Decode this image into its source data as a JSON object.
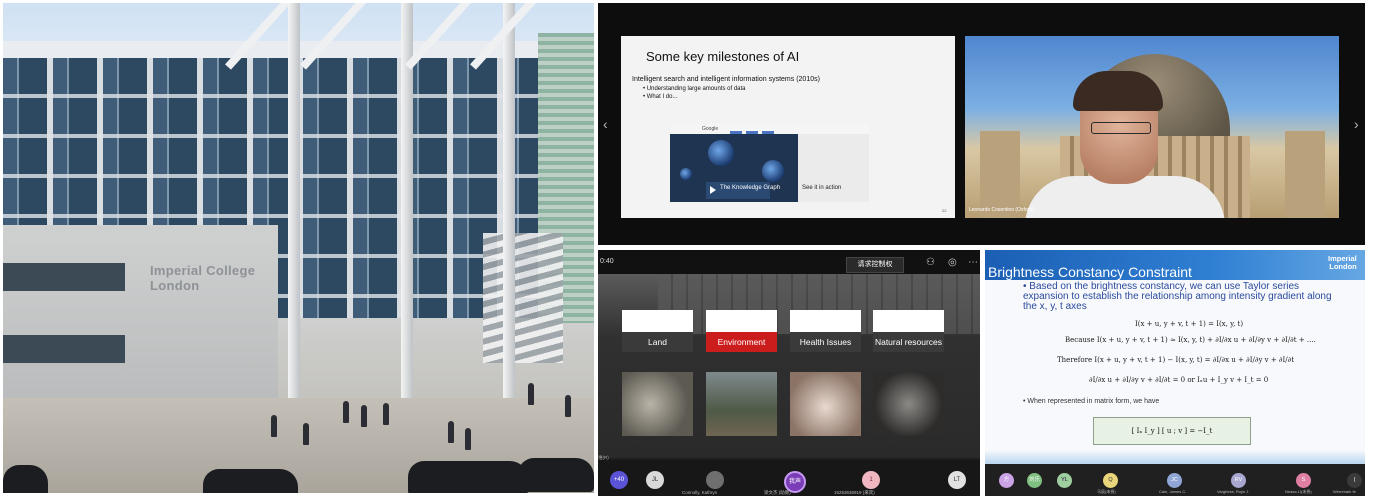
{
  "building": {
    "sign_line1": "Imperial College",
    "sign_line2": "London"
  },
  "lecture": {
    "slide_title": "Some key milestones of AI",
    "slide_subtitle": "Intelligent search and intelligent information systems (2010s)",
    "bullets": [
      "• Understanding large amounts of data",
      "• What I do..."
    ],
    "screenshot_logo": "Google",
    "knowledge_graph_label": "The Knowledge Graph",
    "see_it_label": "See it in action",
    "page_number": "22",
    "speaker_tag": "Leonardo Cosentino (Oxford)",
    "nav_prev": "‹",
    "nav_next": "›"
  },
  "meeting": {
    "time": "0:40",
    "control_button": "请求控制权",
    "categories": [
      "Land",
      "Environment",
      "Health Issues",
      "Natural resources"
    ],
    "highlight_color": "#cc1d1d",
    "participants": [
      "+40",
      "JL",
      "",
      "我声",
      "1",
      "LT"
    ],
    "names": [
      "Connolly, Kathryn",
      "梁文杰 (助教)",
      "15253636919 (来宾)"
    ],
    "side_label": "谁(R)"
  },
  "vision_slide": {
    "title": "Brightness Constancy Constraint",
    "logo_line1": "Imperial",
    "logo_line2": "London",
    "bullet": "• Based on the brightness constancy, we can use Taylor series expansion to establish the relationship among intensity gradient along the x, y, t axes",
    "eq1": "I(x + u, y + v, t + 1) = I(x, y, t)",
    "eq2": "Because  I(x + u, y + v, t + 1) ≈ I(x, y, t) + ∂I/∂x u + ∂I/∂y v + ∂I/∂t + ....",
    "eq3": "Therefore   I(x + u, y + v, t + 1) − I(x, y, t) = ∂I/∂x u + ∂I/∂y v + ∂I/∂t",
    "eq4": "∂I/∂x u + ∂I/∂y v + ∂I/∂t = 0   or   Iₓu + I_y v + I_t = 0",
    "bullet2": "• When represented in matrix form, we have",
    "matrix": "[ Iₓ  I_y ] [ u ; v ] = −I_t",
    "participants": [
      "方",
      "刘乐",
      "YL",
      "Q",
      "JC",
      "RV",
      "S",
      "("
    ],
    "names": [
      "马辰(未授)",
      "Cain, James C.",
      "Varghese, Rojin J.",
      "Neasa LI(未授)",
      "Wernmark fe"
    ]
  }
}
